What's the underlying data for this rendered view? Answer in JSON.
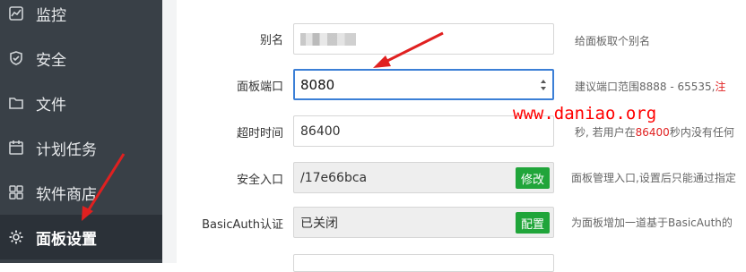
{
  "sidebar": {
    "items": [
      {
        "label": "监控",
        "icon": "monitor-icon"
      },
      {
        "label": "安全",
        "icon": "shield-icon"
      },
      {
        "label": "文件",
        "icon": "folder-icon"
      },
      {
        "label": "计划任务",
        "icon": "calendar-icon"
      },
      {
        "label": "软件商店",
        "icon": "grid-icon"
      },
      {
        "label": "面板设置",
        "icon": "gear-icon",
        "active": true
      }
    ]
  },
  "form": {
    "alias": {
      "label": "别名",
      "hint": "给面板取个别名"
    },
    "port": {
      "label": "面板端口",
      "value": "8080",
      "hint_prefix": "建议端口范围8888 - 65535,",
      "hint_red": "注"
    },
    "timeout": {
      "label": "超时时间",
      "value": "86400",
      "hint_prefix": "秒, 若用户在",
      "hint_red": "86400",
      "hint_suffix": "秒内没有任何"
    },
    "entry": {
      "label": "安全入口",
      "value": "/17e66bca",
      "button": "修改",
      "hint": "面板管理入口,设置后只能通过指定"
    },
    "basicauth": {
      "label": "BasicAuth认证",
      "value": "已关闭",
      "button": "配置",
      "hint": "为面板增加一道基于BasicAuth的"
    }
  },
  "watermark": "www.daniao.org",
  "colors": {
    "sidebar": "#394047",
    "accent": "#20a53a",
    "annotation": "#e02020"
  }
}
